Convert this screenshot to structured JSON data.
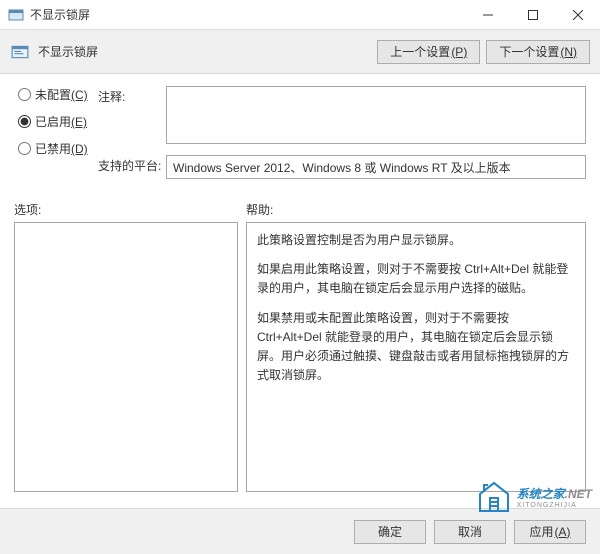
{
  "window": {
    "title": "不显示锁屏",
    "policy_title": "不显示锁屏"
  },
  "toolbar": {
    "prev": "上一个设置",
    "prev_key": "(P)",
    "next": "下一个设置",
    "next_key": "(N)"
  },
  "radios": {
    "not_configured": "未配置",
    "not_configured_key": "(C)",
    "enabled": "已启用",
    "enabled_key": "(E)",
    "disabled": "已禁用",
    "disabled_key": "(D)",
    "selected": "enabled"
  },
  "labels": {
    "comment": "注释:",
    "platforms": "支持的平台:",
    "options": "选项:",
    "help": "帮助:"
  },
  "fields": {
    "comment": "",
    "platforms": "Windows Server 2012、Windows 8 或 Windows RT 及以上版本"
  },
  "help": {
    "p1": "此策略设置控制是否为用户显示锁屏。",
    "p2": "如果启用此策略设置，则对于不需要按 Ctrl+Alt+Del 就能登录的用户，其电脑在锁定后会显示用户选择的磁贴。",
    "p3": "如果禁用或未配置此策略设置，则对于不需要按 Ctrl+Alt+Del 就能登录的用户，其电脑在锁定后会显示锁屏。用户必须通过触摸、键盘敲击或者用鼠标拖拽锁屏的方式取消锁屏。"
  },
  "footer": {
    "ok": "确定",
    "cancel": "取消",
    "apply": "应用",
    "apply_key": "(A)"
  },
  "watermark": {
    "t1": "系统之家",
    "t2": ".NET",
    "sub": "XITONGZHIJIA"
  }
}
